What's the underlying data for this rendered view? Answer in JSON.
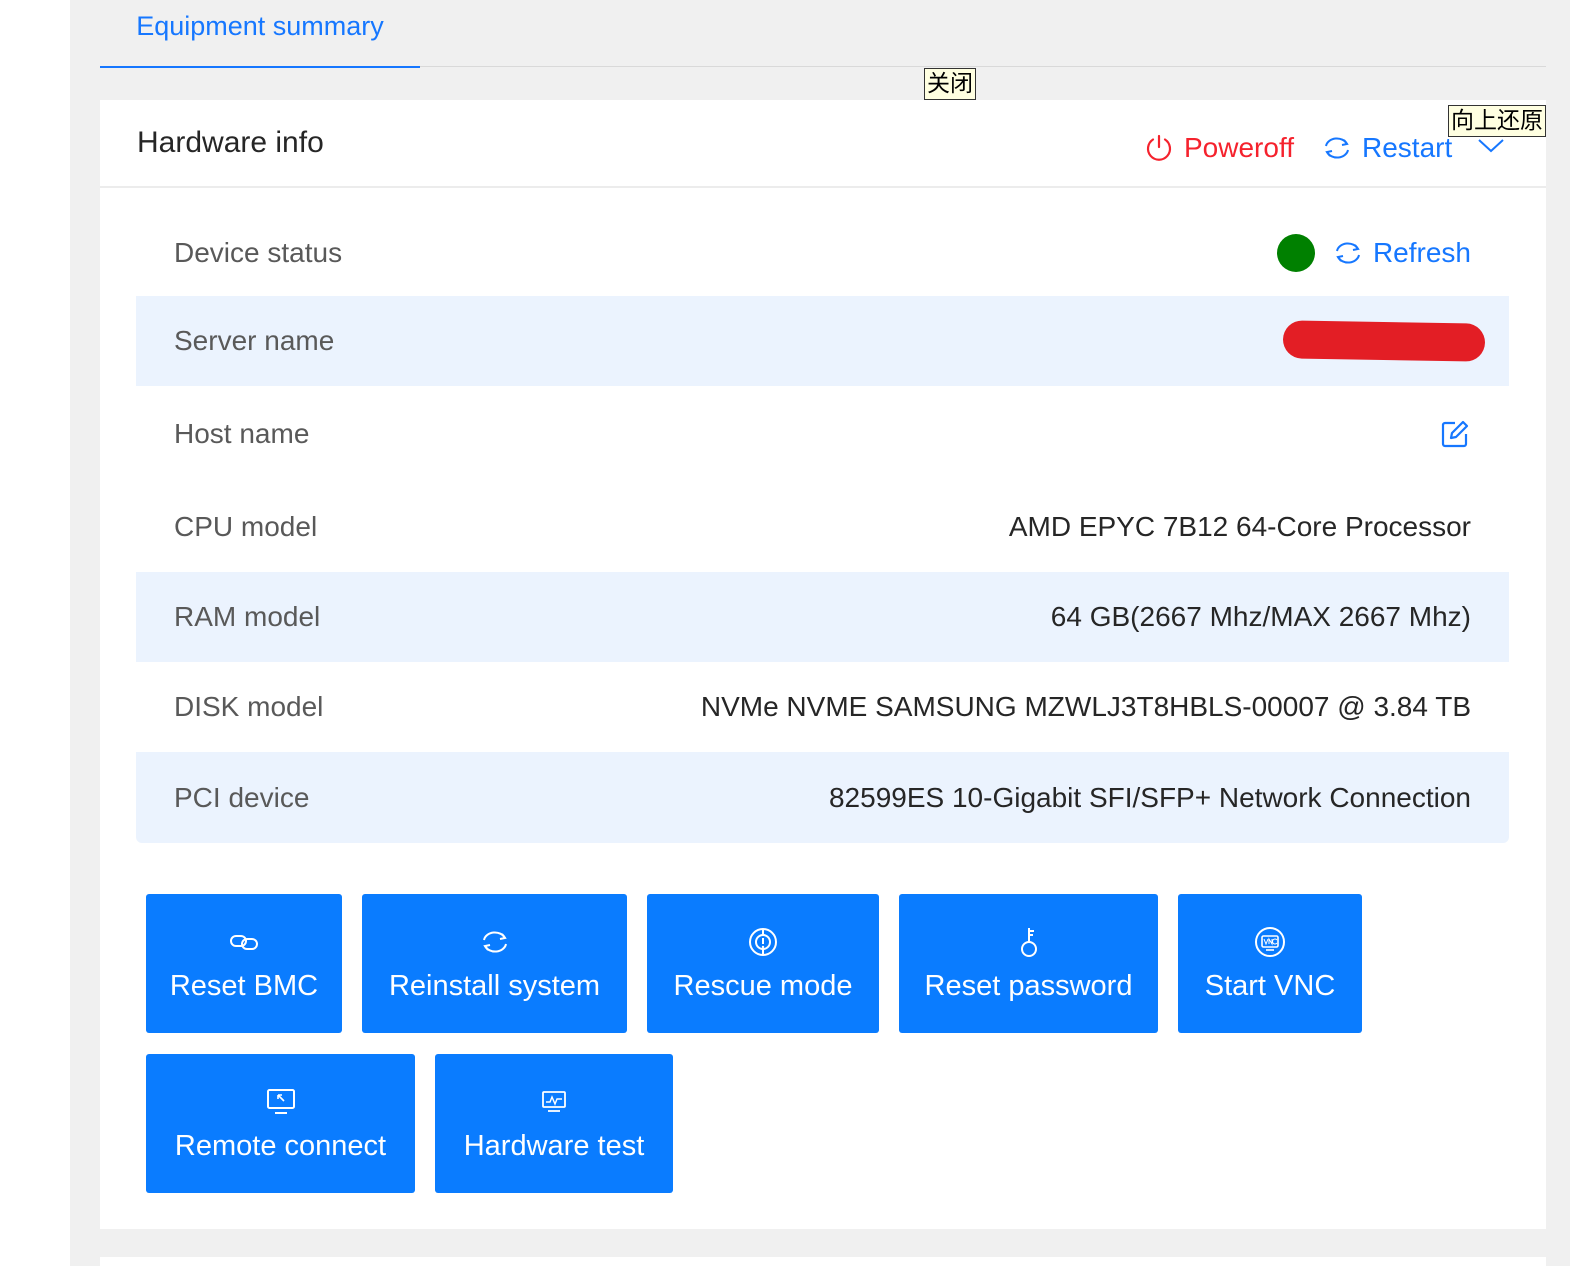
{
  "tabs": {
    "active_label": "Equipment summary"
  },
  "tooltips": {
    "close": "关闭",
    "restore_up": "向上还原"
  },
  "card": {
    "title": "Hardware info",
    "poweroff_label": "Poweroff",
    "restart_label": "Restart"
  },
  "rows": {
    "device_status": {
      "label": "Device status",
      "status_color": "#008000",
      "refresh_label": "Refresh"
    },
    "server_name": {
      "label": "Server name",
      "value_redacted": true
    },
    "host_name": {
      "label": "Host name"
    },
    "cpu_model": {
      "label": "CPU model",
      "value": "AMD EPYC 7B12 64-Core Processor"
    },
    "ram_model": {
      "label": "RAM model",
      "value": "64 GB(2667 Mhz/MAX 2667 Mhz)"
    },
    "disk_model": {
      "label": "DISK model",
      "value": "NVMe NVME SAMSUNG MZWLJ3T8HBLS-00007 @ 3.84 TB"
    },
    "pci_device": {
      "label": "PCI device",
      "value": "82599ES 10-Gigabit SFI/SFP+ Network Connection"
    }
  },
  "actions": {
    "reset_bmc": "Reset BMC",
    "reinstall_system": "Reinstall system",
    "rescue_mode": "Rescue mode",
    "reset_password": "Reset password",
    "start_vnc": "Start VNC",
    "remote_connect": "Remote connect",
    "hardware_test": "Hardware test"
  },
  "colors": {
    "accent": "#1677ff",
    "danger": "#f5222d",
    "button_bg": "#0a7cff",
    "stripe": "#ebf3fe"
  }
}
